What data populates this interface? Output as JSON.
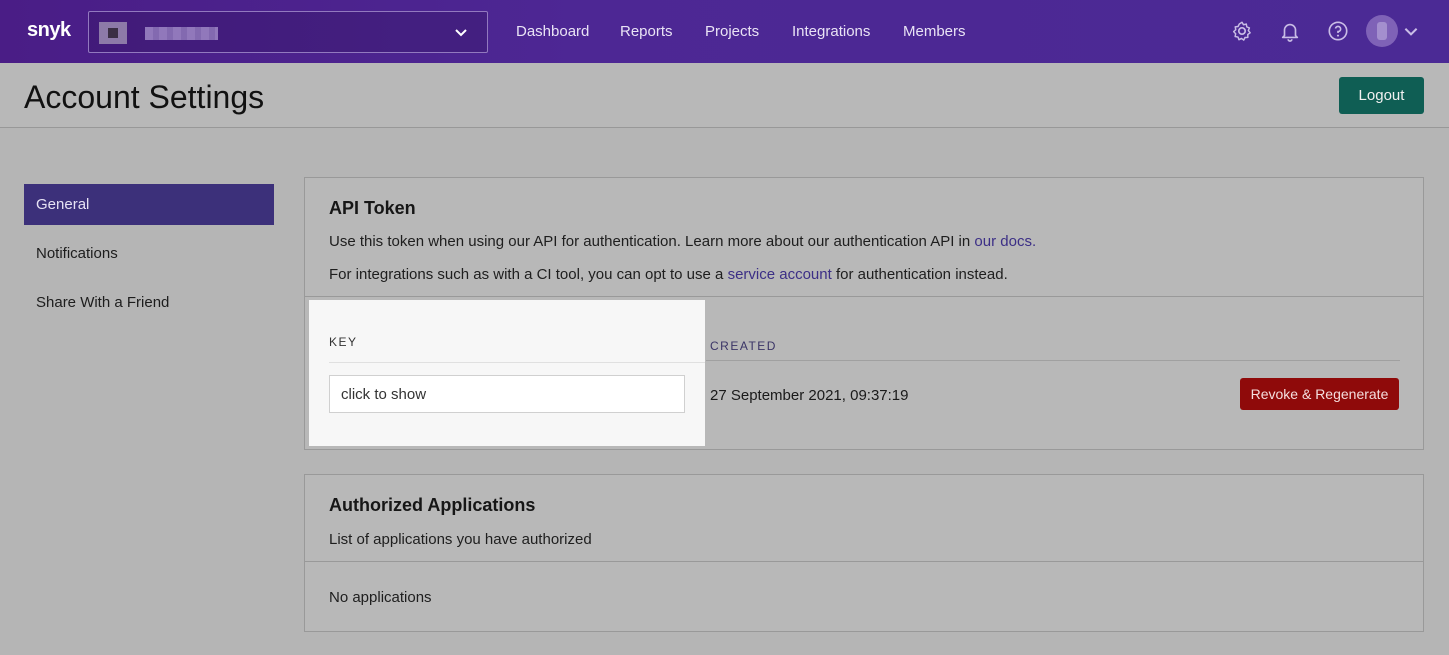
{
  "nav": {
    "logo": "snyk",
    "links": [
      "Dashboard",
      "Reports",
      "Projects",
      "Integrations",
      "Members"
    ],
    "icons": [
      "gear-icon",
      "bell-icon",
      "help-icon",
      "chevron-down-icon"
    ]
  },
  "header": {
    "title": "Account Settings",
    "logout_label": "Logout"
  },
  "sidebar": {
    "items": [
      {
        "label": "General",
        "active": true
      },
      {
        "label": "Notifications",
        "active": false
      },
      {
        "label": "Share With a Friend",
        "active": false
      }
    ]
  },
  "api_token": {
    "title": "API Token",
    "line1_text": "Use this token when using our API for authentication. Learn more about our authentication API in ",
    "line1_link": "our docs.",
    "line2_before": "For integrations such as with a CI tool, you can opt to use a ",
    "line2_link": "service account",
    "line2_after": " for authentication instead.",
    "key_header": "KEY",
    "created_header": "CREATED",
    "key_placeholder": "click to show",
    "created_value": "27 September 2021, 09:37:19",
    "revoke_label": "Revoke & Regenerate"
  },
  "authorized_apps": {
    "title": "Authorized Applications",
    "subtitle": "List of applications you have authorized",
    "empty_text": "No applications"
  },
  "colors": {
    "nav": "#4b2a95",
    "sidebar_active": "#3c307a",
    "logout": "#0f5e54",
    "revoke": "#8f0a0a",
    "link": "#3c2f86"
  }
}
